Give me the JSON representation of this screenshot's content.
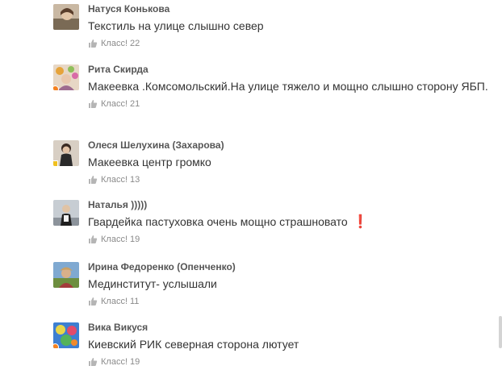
{
  "comments": [
    {
      "author": "Натуся Конькова",
      "text": "Текстиль на улице слышно север",
      "like_label": "Класс!",
      "like_count": "22",
      "avatar_icon": "photo-avatar",
      "status": "none"
    },
    {
      "author": "Рита Скирда",
      "text": "Макеевка .Комсомольский.На улице тяжело и мощно слышно сторону ЯБП.",
      "like_label": "Класс!",
      "like_count": "21",
      "avatar_icon": "photo-avatar",
      "status": "online-dot"
    },
    {
      "author": "Олеся Шелухина (Захарова)",
      "text": "Макеевка центр громко",
      "like_label": "Класс!",
      "like_count": "13",
      "avatar_icon": "photo-avatar",
      "status": "mobile-icon"
    },
    {
      "author": "Наталья )))))",
      "text": "Гвардейка пастуховка очень мощно страшновато",
      "text_suffix": "❗",
      "like_label": "Класс!",
      "like_count": "19",
      "avatar_icon": "photo-avatar",
      "status": "none"
    },
    {
      "author": "Ирина Федоренко (Опенченко)",
      "text": "Мединститут- услышали",
      "like_label": "Класс!",
      "like_count": "11",
      "avatar_icon": "photo-avatar",
      "status": "none"
    },
    {
      "author": "Вика Викуся",
      "text": "Киевский РИК северная сторона лютует",
      "like_label": "Класс!",
      "like_count": "19",
      "avatar_icon": "photo-avatar",
      "status": "online-dot"
    }
  ],
  "colors": {
    "author": "#555555",
    "text": "#333333",
    "like": "#8a8a8a",
    "status_dot": "#f58220",
    "exclamation": "#d0021b"
  },
  "like_icon": "thumbs-up-icon"
}
